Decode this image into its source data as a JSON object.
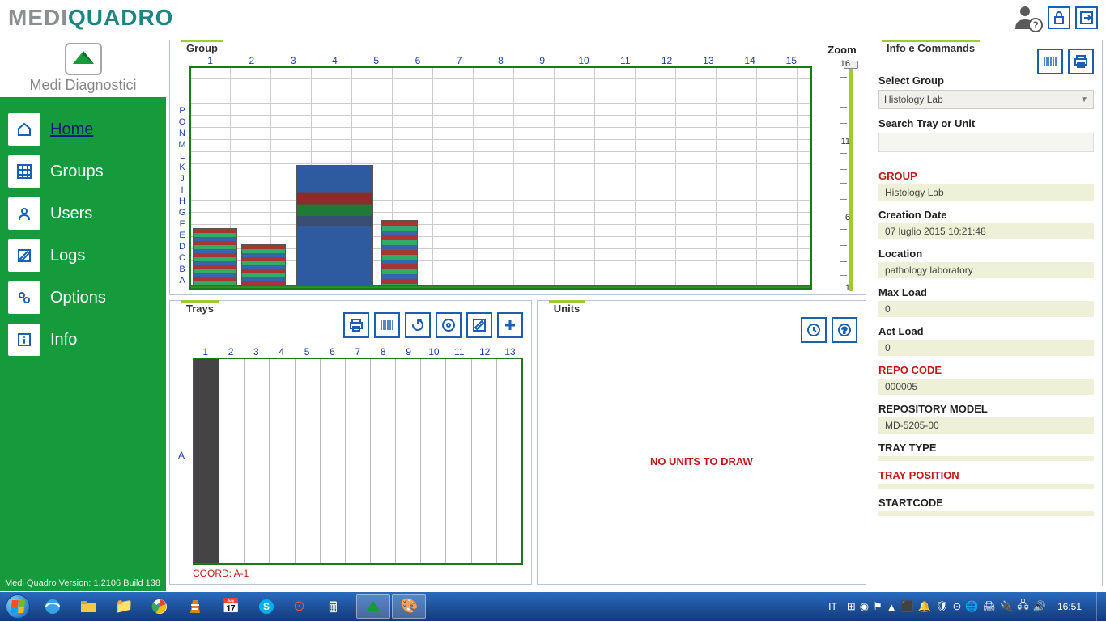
{
  "topbar": {
    "brand_part1": "MEDI",
    "brand_part2": "QUADRO"
  },
  "sublogo": {
    "text": "Medi Diagnostici"
  },
  "nav": {
    "home": "Home",
    "groups": "Groups",
    "users": "Users",
    "logs": "Logs",
    "options": "Options",
    "info": "Info"
  },
  "version": "Medi Quadro Version: 1.2106 Build 138",
  "groupPanel": {
    "title": "Group",
    "cols": [
      "1",
      "2",
      "3",
      "4",
      "5",
      "6",
      "7",
      "8",
      "9",
      "10",
      "11",
      "12",
      "13",
      "14",
      "15"
    ],
    "rows": [
      "P",
      "O",
      "N",
      "M",
      "L",
      "K",
      "J",
      "I",
      "H",
      "G",
      "F",
      "E",
      "D",
      "C",
      "B",
      "A"
    ]
  },
  "zoom": {
    "title": "Zoom",
    "ticks": {
      "top": "16",
      "upper": "11",
      "mid": "6",
      "bottom": "1"
    }
  },
  "traysPanel": {
    "title": "Trays",
    "cols": [
      "1",
      "2",
      "3",
      "4",
      "5",
      "6",
      "7",
      "8",
      "9",
      "10",
      "11",
      "12",
      "13"
    ],
    "rowLabel": "A",
    "coord": "COORD: A-1"
  },
  "unitsPanel": {
    "title": "Units",
    "empty": "NO UNITS TO DRAW"
  },
  "infoPanel": {
    "title": "Info e Commands",
    "selectGroupLabel": "Select Group",
    "selectGroupValue": "Histology Lab",
    "searchLabel": "Search Tray or Unit",
    "groupHeader": "GROUP",
    "groupValue": "Histology Lab",
    "creationDateLabel": "Creation Date",
    "creationDateValue": "07 luglio 2015 10:21:48",
    "locationLabel": "Location",
    "locationValue": "pathology laboratory",
    "maxLoadLabel": "Max Load",
    "maxLoadValue": "0",
    "actLoadLabel": "Act Load",
    "actLoadValue": "0",
    "repoCodeLabel": "REPO CODE",
    "repoCodeValue": "000005",
    "repoModelLabel": "REPOSITORY MODEL",
    "repoModelValue": "MD-5205-00",
    "trayTypeLabel": "TRAY TYPE",
    "trayTypeValue": "",
    "trayPosLabel": "TRAY POSITION",
    "trayPosValue": "",
    "startCodeLabel": "STARTCODE",
    "startCodeValue": ""
  },
  "taskbar": {
    "lang": "IT",
    "clock": "16:51"
  }
}
